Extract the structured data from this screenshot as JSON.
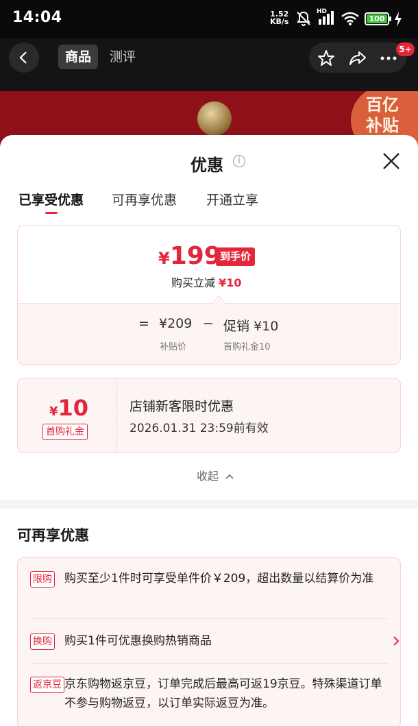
{
  "status_bar": {
    "time": "14:04",
    "net_speed_value": "1.52",
    "net_speed_unit": "KB/s",
    "hd_label": "HD",
    "battery": "100"
  },
  "nav": {
    "tabs": [
      {
        "label": "商品",
        "active": true
      },
      {
        "label": "测评",
        "active": false
      }
    ],
    "badge": "5+"
  },
  "banner": {
    "subsidy_line1": "百亿",
    "subsidy_line2": "补贴"
  },
  "sheet": {
    "title": "优惠",
    "info_glyph": "i",
    "segments": [
      {
        "label": "已享受优惠",
        "active": true
      },
      {
        "label": "可再享优惠",
        "active": false
      },
      {
        "label": "开通立享",
        "active": false
      }
    ],
    "price_card": {
      "currency": "¥",
      "final_price": "199",
      "final_price_tag": "到手价",
      "discount_label": "购买立减",
      "discount_value": "¥10",
      "equals": "=",
      "base_price": "¥209",
      "base_price_label": "补贴价",
      "minus": "−",
      "promo_label": "促销",
      "promo_value": "¥10",
      "promo_sub_label": "首购礼金10"
    },
    "coupon": {
      "currency": "¥",
      "amount": "10",
      "tag": "首购礼金",
      "title": "店铺新客限时优惠",
      "valid_until": "2026.01.31 23:59前有效"
    },
    "collapse_label": "收起",
    "more_section": {
      "title": "可再享优惠",
      "items": [
        {
          "tag": "限购",
          "text": "购买至少1件时可享受单件价￥209，超出数量以结算价为准"
        },
        {
          "tag": "换购",
          "text": "购买1件可优惠换购热销商品",
          "has_chevron": true
        },
        {
          "tag": "返京豆",
          "text": "京东购物返京豆，订单完成后最高可返19京豆。特殊渠道订单不参与购物返豆，以订单实际返豆为准。"
        }
      ]
    }
  },
  "colors": {
    "accent": "#e3263a",
    "card_border": "#f7d2d5",
    "card_bg": "#fdf4f4",
    "status_bg": "#0a0a0a",
    "banner_bg": "#8e1018"
  }
}
